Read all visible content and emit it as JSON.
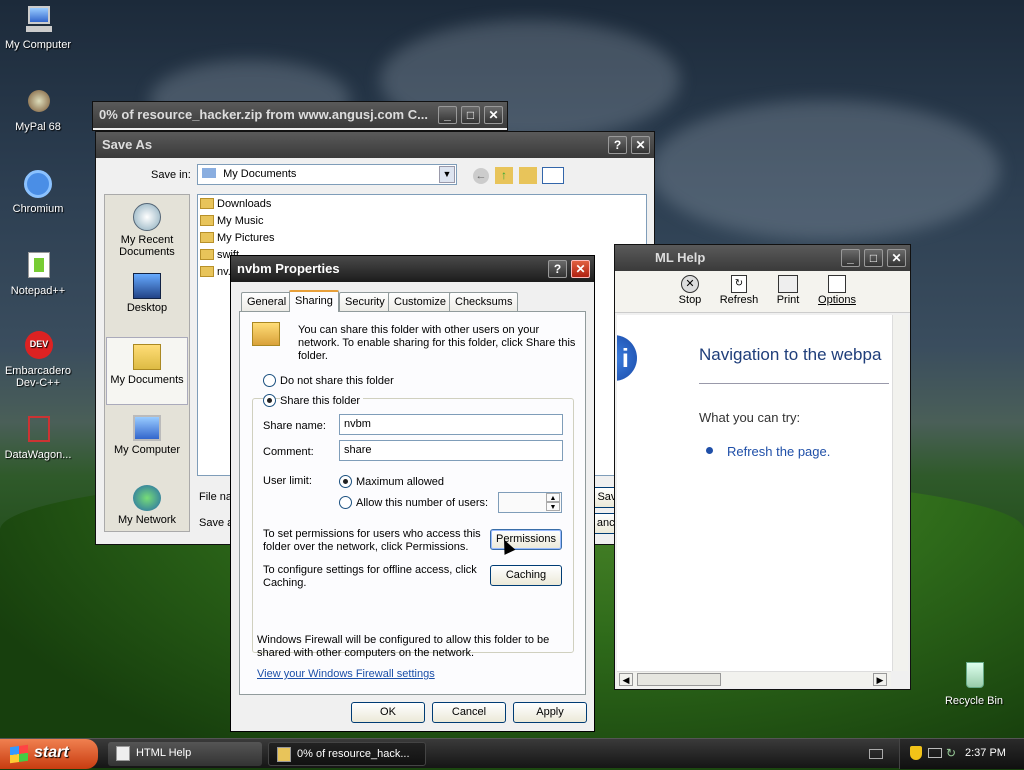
{
  "desktop": {
    "icons": [
      {
        "label": "My Computer"
      },
      {
        "label": "MyPal 68"
      },
      {
        "label": "Chromium"
      },
      {
        "label": "Notepad++"
      },
      {
        "label": "Embarcadero Dev-C++"
      },
      {
        "label": "DataWagon..."
      },
      {
        "label": "Recycle Bin"
      }
    ]
  },
  "download_window": {
    "title": "0% of resource_hacker.zip from www.angusj.com C..."
  },
  "save_as": {
    "title": "Save As",
    "save_in_label": "Save in:",
    "save_in_value": "My Documents",
    "places": [
      "My Recent Documents",
      "Desktop",
      "My Documents",
      "My Computer",
      "My Network"
    ],
    "files": [
      "Downloads",
      "My Music",
      "My Pictures",
      "swift...",
      "nv..."
    ],
    "file_name_label": "File na",
    "save_type_label": "Save a",
    "save_button": "Save",
    "cancel_button": "ancel"
  },
  "html_help": {
    "title": "ML Help",
    "toolbar": [
      "Stop",
      "Refresh",
      "Print",
      "Options"
    ],
    "heading": "Navigation to the webpa",
    "try_text": "What you can try:",
    "refresh_link": "Refresh the page."
  },
  "properties": {
    "title": "nvbm Properties",
    "tabs": [
      "General",
      "Sharing",
      "Security",
      "Customize",
      "Checksums"
    ],
    "intro": "You can share this folder with other users on your network.  To enable sharing for this folder, click Share this folder.",
    "do_not_share": "Do not share this folder",
    "share_this": "Share this folder",
    "share_name_label": "Share name:",
    "share_name_value": "nvbm",
    "comment_label": "Comment:",
    "comment_value": "share",
    "user_limit_label": "User limit:",
    "max_allowed": "Maximum allowed",
    "allow_number": "Allow this number of users:",
    "permissions_text": "To set permissions for users who access this folder over the network, click Permissions.",
    "permissions_button": "Permissions",
    "caching_text": "To configure settings for offline access, click Caching.",
    "caching_button": "Caching",
    "firewall_text": "Windows Firewall will be configured to allow this folder to be shared with other computers on the network.",
    "firewall_link": "View your Windows Firewall settings",
    "ok": "OK",
    "cancel": "Cancel",
    "apply": "Apply"
  },
  "taskbar": {
    "start": "start",
    "tasks": [
      "HTML Help",
      "0% of resource_hack..."
    ],
    "clock": "2:37 PM"
  }
}
